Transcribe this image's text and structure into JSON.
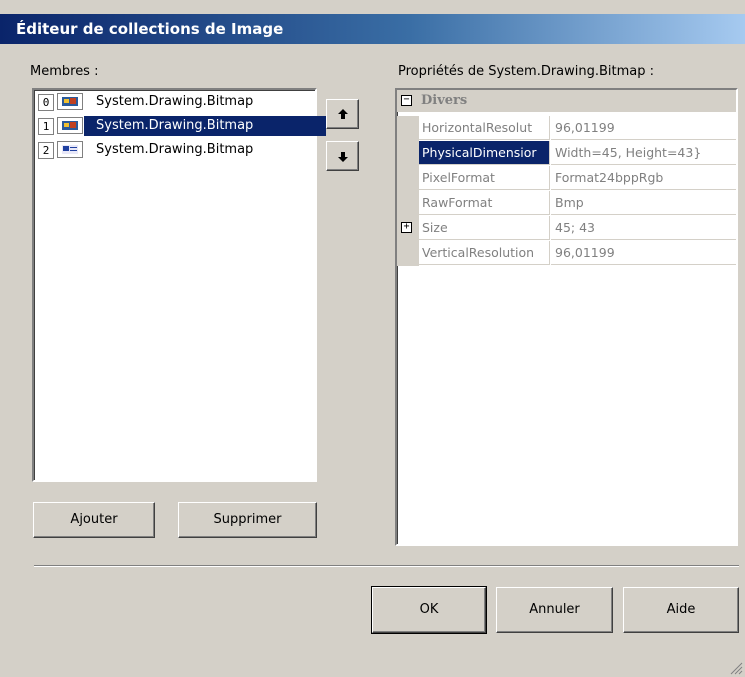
{
  "window": {
    "title": "Éditeur de collections de Image"
  },
  "members": {
    "label": "Membres :",
    "items": [
      {
        "index": "0",
        "text": "System.Drawing.Bitmap",
        "icon": "bitmap-thumbnail-icon",
        "selected": false
      },
      {
        "index": "1",
        "text": "System.Drawing.Bitmap",
        "icon": "bitmap-thumbnail-icon",
        "selected": true
      },
      {
        "index": "2",
        "text": "System.Drawing.Bitmap",
        "icon": "bitmap-thumbnail-icon",
        "selected": false
      }
    ],
    "move_up_icon": "arrow-up-icon",
    "move_down_icon": "arrow-down-icon"
  },
  "buttons": {
    "add": "Ajouter",
    "remove": "Supprimer",
    "ok": "OK",
    "cancel": "Annuler",
    "help": "Aide"
  },
  "properties": {
    "label": "Propriétés de System.Drawing.Bitmap :",
    "category": {
      "name": "Divers",
      "sign": "⊟"
    },
    "rows": [
      {
        "name": "HorizontalResolut",
        "value": "96,01199",
        "selected": false,
        "expandable": false
      },
      {
        "name": "PhysicalDimensior",
        "value": "Width=45, Height=43}",
        "selected": true,
        "expandable": false
      },
      {
        "name": "PixelFormat",
        "value": "Format24bppRgb",
        "selected": false,
        "expandable": false
      },
      {
        "name": "RawFormat",
        "value": "Bmp",
        "selected": false,
        "expandable": false
      },
      {
        "name": "Size",
        "value": "45; 43",
        "selected": false,
        "expandable": true
      },
      {
        "name": "VerticalResolution",
        "value": "96,01199",
        "selected": false,
        "expandable": false
      }
    ]
  },
  "colors": {
    "selection": "#0a246a",
    "title_gradient_start": "#0a246a",
    "title_gradient_end": "#a6caf0",
    "dialog_background": "#d4d0c8"
  }
}
